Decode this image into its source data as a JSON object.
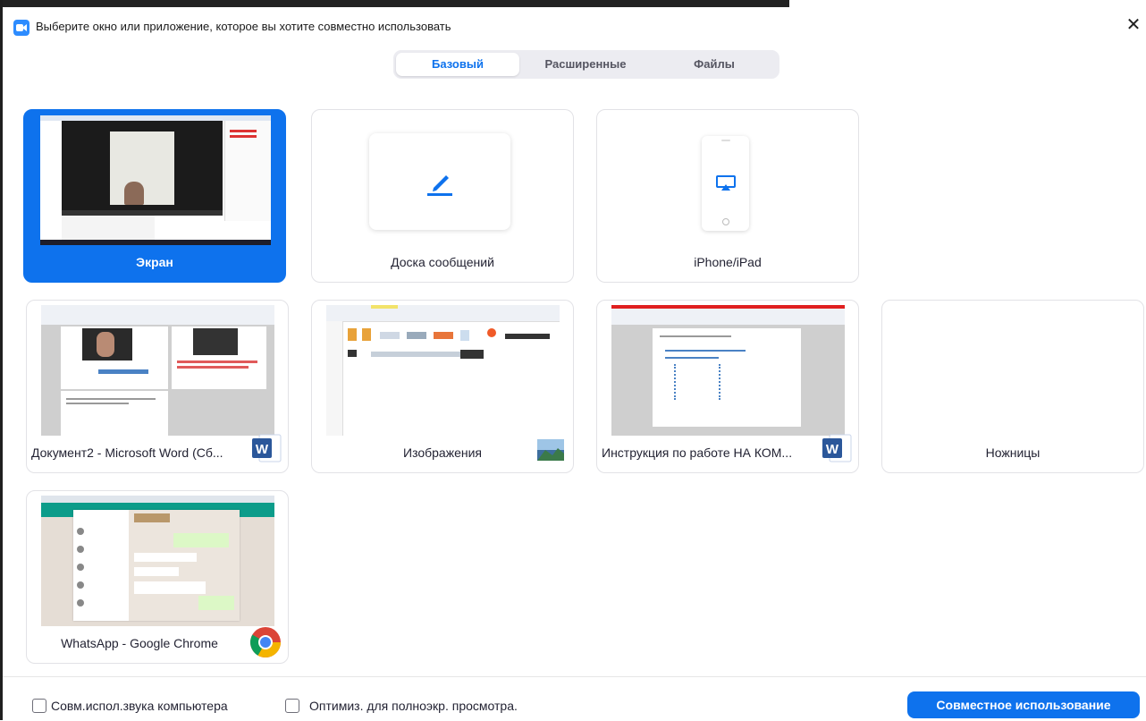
{
  "window": {
    "title": "Выберите окно или приложение, которое вы хотите совместно использовать",
    "close_glyph": "✕",
    "app_icon": "zoom-camera-icon"
  },
  "tabs": [
    {
      "label": "Базовый",
      "active": true
    },
    {
      "label": "Расширенные",
      "active": false
    },
    {
      "label": "Файлы",
      "active": false
    }
  ],
  "tiles": [
    {
      "label": "Экран",
      "selected": true,
      "kind": "screen"
    },
    {
      "label": "Доска сообщений",
      "selected": false,
      "kind": "whiteboard",
      "icon": "pen-icon"
    },
    {
      "label": "iPhone/iPad",
      "selected": false,
      "kind": "device",
      "icon": "airplay-icon"
    },
    {
      "label": "Документ2 - Microsoft Word (Сб...",
      "selected": false,
      "kind": "window",
      "icon": "word-icon"
    },
    {
      "label": "Изображения",
      "selected": false,
      "kind": "window",
      "icon": "photos-icon"
    },
    {
      "label": "Инструкция по работе НА КОМ...",
      "selected": false,
      "kind": "window",
      "icon": "word-icon"
    },
    {
      "label": "Ножницы",
      "selected": false,
      "kind": "window"
    },
    {
      "label": "WhatsApp - Google Chrome",
      "selected": false,
      "kind": "window",
      "icon": "chrome-icon"
    }
  ],
  "footer": {
    "share_sound_label": "Совм.испол.звука компьютера",
    "share_sound_checked": false,
    "optimize_label": "Оптимиз. для полноэкр. просмотра.",
    "optimize_checked": false,
    "share_button": "Совместное использование"
  },
  "colors": {
    "accent": "#0e72ed",
    "tile_border": "#e2e2e6",
    "tab_bg": "#ececf1"
  }
}
